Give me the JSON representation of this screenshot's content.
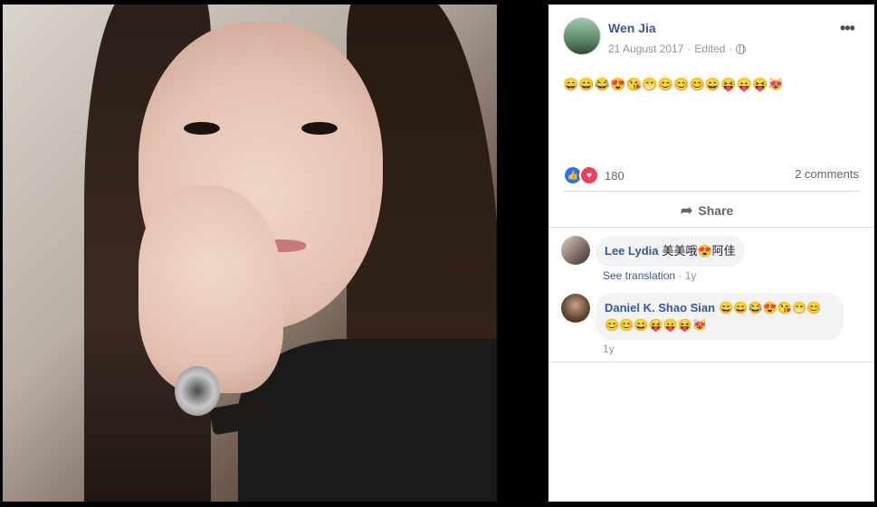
{
  "post": {
    "author": "Wen Jia",
    "date": "21 August 2017",
    "edited": "Edited",
    "separator": "·",
    "text": "😄😄😂😍😘😁😊😊😊😄😝😛😝😻",
    "reaction_count": "180",
    "comments_count": "2 comments",
    "share_label": "Share"
  },
  "comments": [
    {
      "name": "Lee Lydia",
      "text": "美美哦😍阿佳",
      "translate": "See translation",
      "time": "1y"
    },
    {
      "name": "Daniel K. Shao Sian",
      "text": "😄😄😂😍😘😁😊😊😊😄😝😛😝😻",
      "time": "1y"
    }
  ],
  "icons": {
    "more": "more-options-icon",
    "privacy": "globe-icon",
    "share": "share-icon",
    "like": "like-icon",
    "love": "love-icon"
  },
  "colors": {
    "link": "#385898",
    "like": "#2078f4",
    "love": "#f33e58"
  }
}
